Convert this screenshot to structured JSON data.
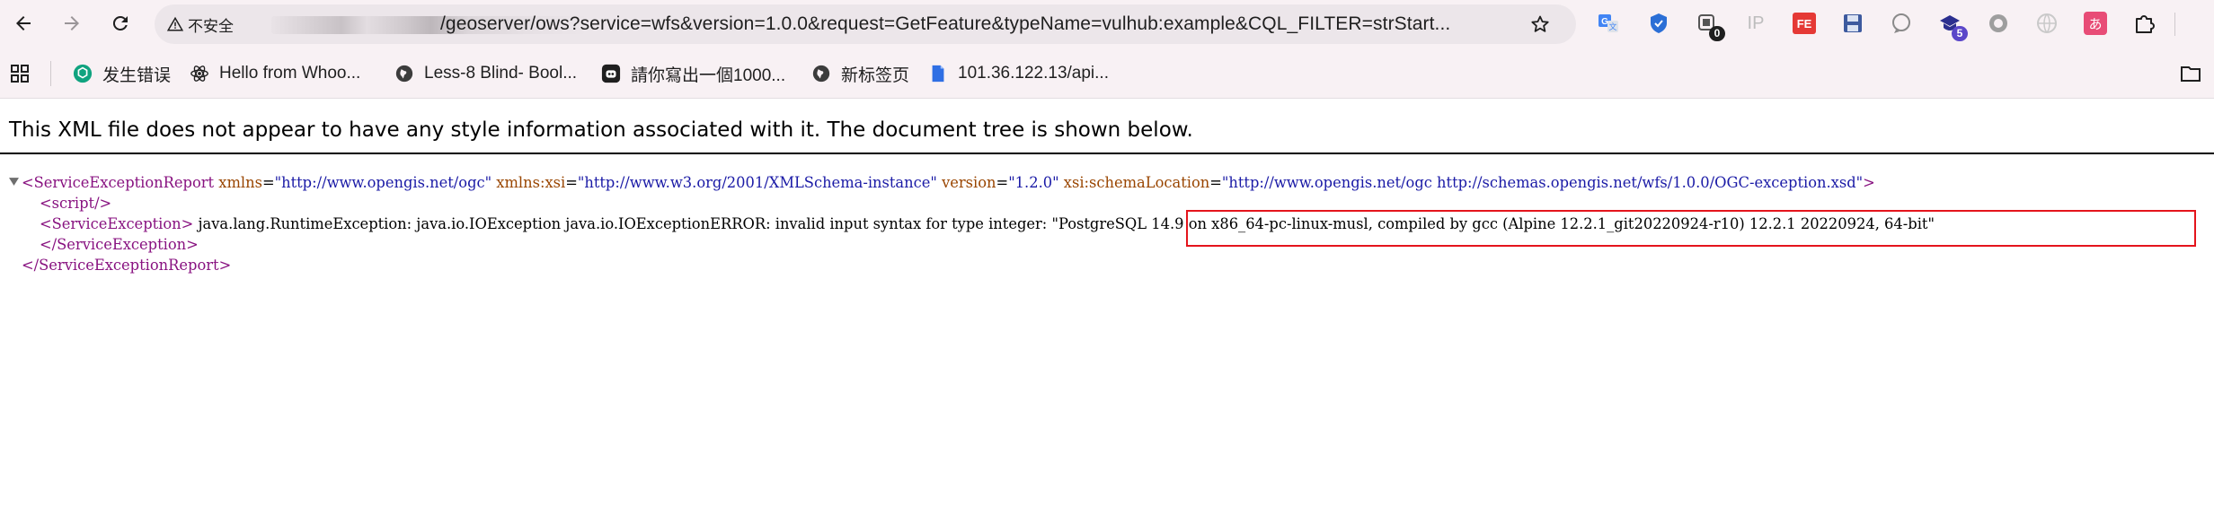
{
  "toolbar": {
    "security_label": "不安全",
    "url_visible": "/geoserver/ows?service=wfs&version=1.0.0&request=GetFeature&typeName=vulhub:example&CQL_FILTER=strStart...",
    "extensions": [
      {
        "name": "translate-icon"
      },
      {
        "name": "shield-icon"
      },
      {
        "name": "counter-icon",
        "badge": "0"
      },
      {
        "name": "ip-icon",
        "text": "IP"
      },
      {
        "name": "fe-icon",
        "text": "FE"
      },
      {
        "name": "save-icon"
      },
      {
        "name": "chat-icon"
      },
      {
        "name": "graduation-icon",
        "badge": "5"
      },
      {
        "name": "circle-icon"
      },
      {
        "name": "globe-icon"
      },
      {
        "name": "anime-icon",
        "text": "あ"
      },
      {
        "name": "puzzle-icon"
      }
    ]
  },
  "bookmarks": [
    {
      "label": "发生错误",
      "icon": "openai-icon"
    },
    {
      "label": "Hello from Whoo...",
      "icon": "react-icon"
    },
    {
      "label": "Less-8 Blind- Bool...",
      "icon": "globe-icon"
    },
    {
      "label": "請你寫出一個1000...",
      "icon": "bot-icon"
    },
    {
      "label": "新标签页",
      "icon": "globe-icon"
    },
    {
      "label": "101.36.122.13/api...",
      "icon": "doc-icon"
    }
  ],
  "page": {
    "notice": "This XML file does not appear to have any style information associated with it. The document tree is shown below.",
    "root_open_tag": "<ServiceExceptionReport",
    "root_attrs": [
      {
        "name": "xmlns",
        "value": "\"http://www.opengis.net/ogc\""
      },
      {
        "name": "xmlns:xsi",
        "value": "\"http://www.w3.org/2001/XMLSchema-instance\""
      },
      {
        "name": "version",
        "value": "\"1.2.0\""
      },
      {
        "name": "xsi:schemaLocation",
        "value": "\"http://www.opengis.net/ogc http://schemas.opengis.net/wfs/1.0.0/OGC-exception.xsd\""
      }
    ],
    "root_open_close": ">",
    "script_tag": "<script/>",
    "exception_open": "<ServiceException>",
    "exception_text": "java.lang.RuntimeException: java.io.IOException java.io.IOExceptionERROR: invalid input syntax for type integer: ",
    "exception_highlight": "\"PostgreSQL 14.9 on x86_64-pc-linux-musl, compiled by gcc (Alpine 12.2.1_git20220924-r10) 12.2.1 20220924, 64-bit\"",
    "exception_close": "</ServiceException>",
    "root_close": "</ServiceExceptionReport>"
  },
  "colors": {
    "tag": "#881280",
    "attribute": "#994500",
    "attribute_value": "#1a1aa6",
    "highlight_border": "#e4141c",
    "chrome_bg": "#f8f1f4"
  }
}
